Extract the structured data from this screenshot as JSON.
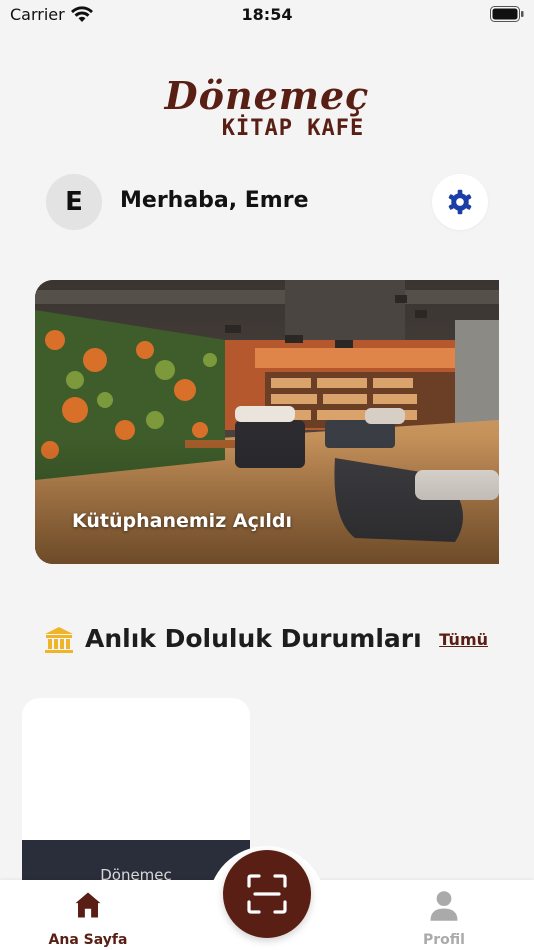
{
  "status_bar": {
    "carrier": "Carrier",
    "time": "18:54"
  },
  "brand": {
    "name": "Dönemeç",
    "subtitle": "KİTAP KAFE",
    "color": "#5a1f14"
  },
  "user": {
    "avatar_initial": "E",
    "greeting": "Merhaba, Emre"
  },
  "icons": {
    "settings": "gear-icon",
    "section": "museum-icon",
    "home": "home-icon",
    "scan": "scan-icon",
    "profile": "person-icon"
  },
  "banner": {
    "caption": "Kütüphanemiz Açıldı"
  },
  "occupancy": {
    "title": "Anlık Doluluk Durumları",
    "see_all": "Tümü",
    "cards": [
      {
        "name": "Dönemeç"
      }
    ]
  },
  "tab_bar": {
    "home_label": "Ana Sayfa",
    "profile_label": "Profil"
  },
  "colors": {
    "accent": "#5a1f14",
    "settings_icon": "#1b3fa6",
    "section_icon": "#f0b429",
    "background": "#f4f4f4",
    "inactive_tab": "#aaaaaa"
  }
}
